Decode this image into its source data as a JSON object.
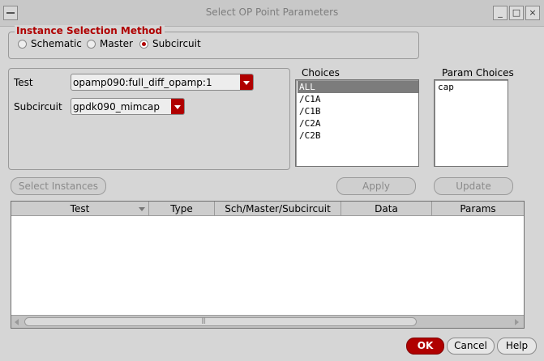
{
  "window": {
    "title": "Select OP Point Parameters",
    "controls": {
      "minimize": "_",
      "maximize": "□",
      "close": "×"
    }
  },
  "instance_selection": {
    "legend": "Instance Selection Method",
    "options": [
      {
        "label": "Schematic",
        "selected": false
      },
      {
        "label": "Master",
        "selected": false
      },
      {
        "label": "Subcircuit",
        "selected": true
      }
    ]
  },
  "fields": {
    "test_label": "Test",
    "test_value": "opamp090:full_diff_opamp:1",
    "subcircuit_label": "Subcircuit",
    "subcircuit_value": "gpdk090_mimcap"
  },
  "choices": {
    "label": "Choices",
    "items": [
      "ALL",
      "/C1A",
      "/C1B",
      "/C2A",
      "/C2B"
    ],
    "selected_index": 0
  },
  "param_choices": {
    "label": "Param Choices",
    "items": [
      "cap"
    ]
  },
  "buttons": {
    "select_instances": "Select Instances",
    "apply": "Apply",
    "update": "Update",
    "ok": "OK",
    "cancel": "Cancel",
    "help": "Help"
  },
  "table": {
    "columns": [
      "Test",
      "Type",
      "Sch/Master/Subcircuit",
      "Data",
      "Params"
    ],
    "rows": []
  },
  "colors": {
    "accent": "#b00000",
    "window_bg": "#d6d6d6",
    "selection_bg": "#7c7c7c"
  }
}
